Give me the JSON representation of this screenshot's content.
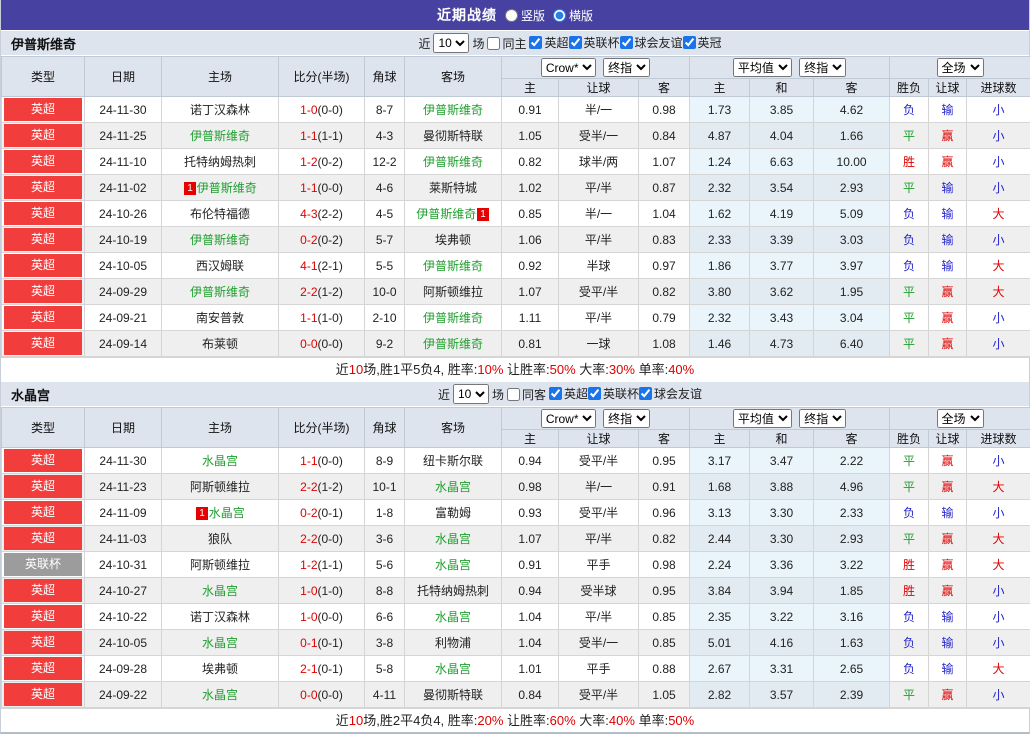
{
  "colors": {
    "title_bar_bg": "#4742a2",
    "league_badge_red": "#f23d3d",
    "league_badge_gray": "#9c9c9c",
    "team_name_green": "#1fa02e",
    "score_red": "#e00000",
    "win_red": "#e00000",
    "draw_green": "#1fa02e",
    "lose_blue": "#2424cc",
    "header_bg": "#dee4ee",
    "avg_column_bg": "#e9f4fb"
  },
  "title_bar": {
    "title": "近期战绩",
    "radios": [
      {
        "label": "竖版",
        "checked": false
      },
      {
        "label": "横版",
        "checked": true
      }
    ]
  },
  "sections": [
    {
      "team": "伊普斯维奇",
      "filter": {
        "near_label": "近",
        "count": "10",
        "games_label": "场",
        "same_label": "同主",
        "same_checked": false,
        "leagues": [
          {
            "label": "英超",
            "checked": true
          },
          {
            "label": "英联杯",
            "checked": true
          },
          {
            "label": "球会友谊",
            "checked": true
          },
          {
            "label": "英冠",
            "checked": true
          }
        ]
      },
      "header": {
        "cols": [
          "类型",
          "日期",
          "主场",
          "比分(半场)",
          "角球",
          "客场"
        ],
        "dropdowns": [
          "Crow*",
          "终指",
          "平均值",
          "终指",
          "全场"
        ],
        "sub": [
          "主",
          "让球",
          "客",
          "主",
          "和",
          "客",
          "胜负",
          "让球",
          "进球数"
        ]
      },
      "rows": [
        {
          "league": "英超",
          "league_color": "red",
          "date": "24-11-30",
          "home": "诺丁汉森林",
          "home_green": false,
          "home_badge": "",
          "score": "1-0",
          "half": "(0-0)",
          "corner": "8-7",
          "away": "伊普斯维奇",
          "away_green": true,
          "away_badge": "",
          "odds_home": "0.91",
          "handicap": "半/一",
          "odds_away": "0.98",
          "avg_home": "1.73",
          "avg_draw": "3.85",
          "avg_away": "4.62",
          "outcome": "负",
          "outcome_color": "blue",
          "handicap_outcome": "输",
          "handicap_outcome_color": "blue",
          "goals": "小",
          "goals_color": "blue"
        },
        {
          "league": "英超",
          "league_color": "red",
          "date": "24-11-25",
          "home": "伊普斯维奇",
          "home_green": true,
          "home_badge": "",
          "score": "1-1",
          "half": "(1-1)",
          "corner": "4-3",
          "away": "曼彻斯特联",
          "away_green": false,
          "away_badge": "",
          "odds_home": "1.05",
          "handicap": "受半/一",
          "odds_away": "0.84",
          "avg_home": "4.87",
          "avg_draw": "4.04",
          "avg_away": "1.66",
          "outcome": "平",
          "outcome_color": "green",
          "handicap_outcome": "赢",
          "handicap_outcome_color": "red",
          "goals": "小",
          "goals_color": "blue"
        },
        {
          "league": "英超",
          "league_color": "red",
          "date": "24-11-10",
          "home": "托特纳姆热刺",
          "home_green": false,
          "home_badge": "",
          "score": "1-2",
          "half": "(0-2)",
          "corner": "12-2",
          "away": "伊普斯维奇",
          "away_green": true,
          "away_badge": "",
          "odds_home": "0.82",
          "handicap": "球半/两",
          "odds_away": "1.07",
          "avg_home": "1.24",
          "avg_draw": "6.63",
          "avg_away": "10.00",
          "outcome": "胜",
          "outcome_color": "red",
          "handicap_outcome": "赢",
          "handicap_outcome_color": "red",
          "goals": "小",
          "goals_color": "blue"
        },
        {
          "league": "英超",
          "league_color": "red",
          "date": "24-11-02",
          "home": "伊普斯维奇",
          "home_green": true,
          "home_badge": "1",
          "score": "1-1",
          "half": "(0-0)",
          "corner": "4-6",
          "away": "莱斯特城",
          "away_green": false,
          "away_badge": "",
          "odds_home": "1.02",
          "handicap": "平/半",
          "odds_away": "0.87",
          "avg_home": "2.32",
          "avg_draw": "3.54",
          "avg_away": "2.93",
          "outcome": "平",
          "outcome_color": "green",
          "handicap_outcome": "输",
          "handicap_outcome_color": "blue",
          "goals": "小",
          "goals_color": "blue"
        },
        {
          "league": "英超",
          "league_color": "red",
          "date": "24-10-26",
          "home": "布伦特福德",
          "home_green": false,
          "home_badge": "",
          "score": "4-3",
          "half": "(2-2)",
          "corner": "4-5",
          "away": "伊普斯维奇",
          "away_green": true,
          "away_badge": "1",
          "odds_home": "0.85",
          "handicap": "半/一",
          "odds_away": "1.04",
          "avg_home": "1.62",
          "avg_draw": "4.19",
          "avg_away": "5.09",
          "outcome": "负",
          "outcome_color": "blue",
          "handicap_outcome": "输",
          "handicap_outcome_color": "blue",
          "goals": "大",
          "goals_color": "red"
        },
        {
          "league": "英超",
          "league_color": "red",
          "date": "24-10-19",
          "home": "伊普斯维奇",
          "home_green": true,
          "home_badge": "",
          "score": "0-2",
          "half": "(0-2)",
          "corner": "5-7",
          "away": "埃弗顿",
          "away_green": false,
          "away_badge": "",
          "odds_home": "1.06",
          "handicap": "平/半",
          "odds_away": "0.83",
          "avg_home": "2.33",
          "avg_draw": "3.39",
          "avg_away": "3.03",
          "outcome": "负",
          "outcome_color": "blue",
          "handicap_outcome": "输",
          "handicap_outcome_color": "blue",
          "goals": "小",
          "goals_color": "blue"
        },
        {
          "league": "英超",
          "league_color": "red",
          "date": "24-10-05",
          "home": "西汉姆联",
          "home_green": false,
          "home_badge": "",
          "score": "4-1",
          "half": "(2-1)",
          "corner": "5-5",
          "away": "伊普斯维奇",
          "away_green": true,
          "away_badge": "",
          "odds_home": "0.92",
          "handicap": "半球",
          "odds_away": "0.97",
          "avg_home": "1.86",
          "avg_draw": "3.77",
          "avg_away": "3.97",
          "outcome": "负",
          "outcome_color": "blue",
          "handicap_outcome": "输",
          "handicap_outcome_color": "blue",
          "goals": "大",
          "goals_color": "red"
        },
        {
          "league": "英超",
          "league_color": "red",
          "date": "24-09-29",
          "home": "伊普斯维奇",
          "home_green": true,
          "home_badge": "",
          "score": "2-2",
          "half": "(1-2)",
          "corner": "10-0",
          "away": "阿斯顿维拉",
          "away_green": false,
          "away_badge": "",
          "odds_home": "1.07",
          "handicap": "受平/半",
          "odds_away": "0.82",
          "avg_home": "3.80",
          "avg_draw": "3.62",
          "avg_away": "1.95",
          "outcome": "平",
          "outcome_color": "green",
          "handicap_outcome": "赢",
          "handicap_outcome_color": "red",
          "goals": "大",
          "goals_color": "red"
        },
        {
          "league": "英超",
          "league_color": "red",
          "date": "24-09-21",
          "home": "南安普敦",
          "home_green": false,
          "home_badge": "",
          "score": "1-1",
          "half": "(1-0)",
          "corner": "2-10",
          "away": "伊普斯维奇",
          "away_green": true,
          "away_badge": "",
          "odds_home": "1.11",
          "handicap": "平/半",
          "odds_away": "0.79",
          "avg_home": "2.32",
          "avg_draw": "3.43",
          "avg_away": "3.04",
          "outcome": "平",
          "outcome_color": "green",
          "handicap_outcome": "赢",
          "handicap_outcome_color": "red",
          "goals": "小",
          "goals_color": "blue"
        },
        {
          "league": "英超",
          "league_color": "red",
          "date": "24-09-14",
          "home": "布莱顿",
          "home_green": false,
          "home_badge": "",
          "score": "0-0",
          "half": "(0-0)",
          "corner": "9-2",
          "away": "伊普斯维奇",
          "away_green": true,
          "away_badge": "",
          "odds_home": "0.81",
          "handicap": "一球",
          "odds_away": "1.08",
          "avg_home": "1.46",
          "avg_draw": "4.73",
          "avg_away": "6.40",
          "outcome": "平",
          "outcome_color": "green",
          "handicap_outcome": "赢",
          "handicap_outcome_color": "red",
          "goals": "小",
          "goals_color": "blue"
        }
      ],
      "summary": [
        {
          "text": "近"
        },
        {
          "text": "10",
          "red": true
        },
        {
          "text": "场,胜1平5负4, 胜率:"
        },
        {
          "text": "10%",
          "red": true
        },
        {
          "text": " 让胜率:"
        },
        {
          "text": "50%",
          "red": true
        },
        {
          "text": " 大率:"
        },
        {
          "text": "30%",
          "red": true
        },
        {
          "text": " 单率:"
        },
        {
          "text": "40%",
          "red": true
        }
      ]
    },
    {
      "team": "水晶宫",
      "filter": {
        "near_label": "近",
        "count": "10",
        "games_label": "场",
        "same_label": "同客",
        "same_checked": false,
        "leagues": [
          {
            "label": "英超",
            "checked": true
          },
          {
            "label": "英联杯",
            "checked": true
          },
          {
            "label": "球会友谊",
            "checked": true
          }
        ]
      },
      "header": {
        "cols": [
          "类型",
          "日期",
          "主场",
          "比分(半场)",
          "角球",
          "客场"
        ],
        "dropdowns": [
          "Crow*",
          "终指",
          "平均值",
          "终指",
          "全场"
        ],
        "sub": [
          "主",
          "让球",
          "客",
          "主",
          "和",
          "客",
          "胜负",
          "让球",
          "进球数"
        ]
      },
      "rows": [
        {
          "league": "英超",
          "league_color": "red",
          "date": "24-11-30",
          "home": "水晶宫",
          "home_green": true,
          "home_badge": "",
          "score": "1-1",
          "half": "(0-0)",
          "corner": "8-9",
          "away": "纽卡斯尔联",
          "away_green": false,
          "away_badge": "",
          "odds_home": "0.94",
          "handicap": "受平/半",
          "odds_away": "0.95",
          "avg_home": "3.17",
          "avg_draw": "3.47",
          "avg_away": "2.22",
          "outcome": "平",
          "outcome_color": "green",
          "handicap_outcome": "赢",
          "handicap_outcome_color": "red",
          "goals": "小",
          "goals_color": "blue"
        },
        {
          "league": "英超",
          "league_color": "red",
          "date": "24-11-23",
          "home": "阿斯顿维拉",
          "home_green": false,
          "home_badge": "",
          "score": "2-2",
          "half": "(1-2)",
          "corner": "10-1",
          "away": "水晶宫",
          "away_green": true,
          "away_badge": "",
          "odds_home": "0.98",
          "handicap": "半/一",
          "odds_away": "0.91",
          "avg_home": "1.68",
          "avg_draw": "3.88",
          "avg_away": "4.96",
          "outcome": "平",
          "outcome_color": "green",
          "handicap_outcome": "赢",
          "handicap_outcome_color": "red",
          "goals": "大",
          "goals_color": "red"
        },
        {
          "league": "英超",
          "league_color": "red",
          "date": "24-11-09",
          "home": "水晶宫",
          "home_green": true,
          "home_badge": "1",
          "score": "0-2",
          "half": "(0-1)",
          "corner": "1-8",
          "away": "富勒姆",
          "away_green": false,
          "away_badge": "",
          "odds_home": "0.93",
          "handicap": "受平/半",
          "odds_away": "0.96",
          "avg_home": "3.13",
          "avg_draw": "3.30",
          "avg_away": "2.33",
          "outcome": "负",
          "outcome_color": "blue",
          "handicap_outcome": "输",
          "handicap_outcome_color": "blue",
          "goals": "小",
          "goals_color": "blue"
        },
        {
          "league": "英超",
          "league_color": "red",
          "date": "24-11-03",
          "home": "狼队",
          "home_green": false,
          "home_badge": "",
          "score": "2-2",
          "half": "(0-0)",
          "corner": "3-6",
          "away": "水晶宫",
          "away_green": true,
          "away_badge": "",
          "odds_home": "1.07",
          "handicap": "平/半",
          "odds_away": "0.82",
          "avg_home": "2.44",
          "avg_draw": "3.30",
          "avg_away": "2.93",
          "outcome": "平",
          "outcome_color": "green",
          "handicap_outcome": "赢",
          "handicap_outcome_color": "red",
          "goals": "大",
          "goals_color": "red"
        },
        {
          "league": "英联杯",
          "league_color": "gray",
          "date": "24-10-31",
          "home": "阿斯顿维拉",
          "home_green": false,
          "home_badge": "",
          "score": "1-2",
          "half": "(1-1)",
          "corner": "5-6",
          "away": "水晶宫",
          "away_green": true,
          "away_badge": "",
          "odds_home": "0.91",
          "handicap": "平手",
          "odds_away": "0.98",
          "avg_home": "2.24",
          "avg_draw": "3.36",
          "avg_away": "3.22",
          "outcome": "胜",
          "outcome_color": "red",
          "handicap_outcome": "赢",
          "handicap_outcome_color": "red",
          "goals": "大",
          "goals_color": "red"
        },
        {
          "league": "英超",
          "league_color": "red",
          "date": "24-10-27",
          "home": "水晶宫",
          "home_green": true,
          "home_badge": "",
          "score": "1-0",
          "half": "(1-0)",
          "corner": "8-8",
          "away": "托特纳姆热刺",
          "away_green": false,
          "away_badge": "",
          "odds_home": "0.94",
          "handicap": "受半球",
          "odds_away": "0.95",
          "avg_home": "3.84",
          "avg_draw": "3.94",
          "avg_away": "1.85",
          "outcome": "胜",
          "outcome_color": "red",
          "handicap_outcome": "赢",
          "handicap_outcome_color": "red",
          "goals": "小",
          "goals_color": "blue"
        },
        {
          "league": "英超",
          "league_color": "red",
          "date": "24-10-22",
          "home": "诺丁汉森林",
          "home_green": false,
          "home_badge": "",
          "score": "1-0",
          "half": "(0-0)",
          "corner": "6-6",
          "away": "水晶宫",
          "away_green": true,
          "away_badge": "",
          "odds_home": "1.04",
          "handicap": "平/半",
          "odds_away": "0.85",
          "avg_home": "2.35",
          "avg_draw": "3.22",
          "avg_away": "3.16",
          "outcome": "负",
          "outcome_color": "blue",
          "handicap_outcome": "输",
          "handicap_outcome_color": "blue",
          "goals": "小",
          "goals_color": "blue"
        },
        {
          "league": "英超",
          "league_color": "red",
          "date": "24-10-05",
          "home": "水晶宫",
          "home_green": true,
          "home_badge": "",
          "score": "0-1",
          "half": "(0-1)",
          "corner": "3-8",
          "away": "利物浦",
          "away_green": false,
          "away_badge": "",
          "odds_home": "1.04",
          "handicap": "受半/一",
          "odds_away": "0.85",
          "avg_home": "5.01",
          "avg_draw": "4.16",
          "avg_away": "1.63",
          "outcome": "负",
          "outcome_color": "blue",
          "handicap_outcome": "输",
          "handicap_outcome_color": "blue",
          "goals": "小",
          "goals_color": "blue"
        },
        {
          "league": "英超",
          "league_color": "red",
          "date": "24-09-28",
          "home": "埃弗顿",
          "home_green": false,
          "home_badge": "",
          "score": "2-1",
          "half": "(0-1)",
          "corner": "5-8",
          "away": "水晶宫",
          "away_green": true,
          "away_badge": "",
          "odds_home": "1.01",
          "handicap": "平手",
          "odds_away": "0.88",
          "avg_home": "2.67",
          "avg_draw": "3.31",
          "avg_away": "2.65",
          "outcome": "负",
          "outcome_color": "blue",
          "handicap_outcome": "输",
          "handicap_outcome_color": "blue",
          "goals": "大",
          "goals_color": "red"
        },
        {
          "league": "英超",
          "league_color": "red",
          "date": "24-09-22",
          "home": "水晶宫",
          "home_green": true,
          "home_badge": "",
          "score": "0-0",
          "half": "(0-0)",
          "corner": "4-11",
          "away": "曼彻斯特联",
          "away_green": false,
          "away_badge": "",
          "odds_home": "0.84",
          "handicap": "受平/半",
          "odds_away": "1.05",
          "avg_home": "2.82",
          "avg_draw": "3.57",
          "avg_away": "2.39",
          "outcome": "平",
          "outcome_color": "green",
          "handicap_outcome": "赢",
          "handicap_outcome_color": "red",
          "goals": "小",
          "goals_color": "blue"
        }
      ],
      "summary": [
        {
          "text": "近"
        },
        {
          "text": "10",
          "red": true
        },
        {
          "text": "场,胜2平4负4, 胜率:"
        },
        {
          "text": "20%",
          "red": true
        },
        {
          "text": " 让胜率:"
        },
        {
          "text": "60%",
          "red": true
        },
        {
          "text": " 大率:"
        },
        {
          "text": "40%",
          "red": true
        },
        {
          "text": " 单率:"
        },
        {
          "text": "50%",
          "red": true
        }
      ]
    }
  ]
}
